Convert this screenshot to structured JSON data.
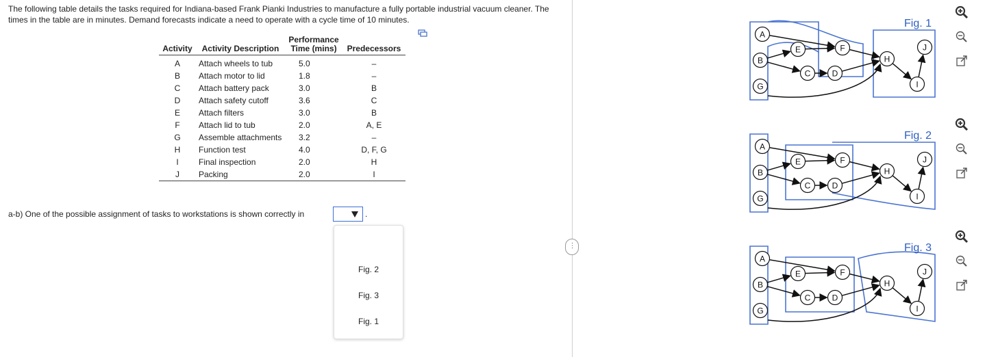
{
  "intro": "The following table details the tasks required for Indiana-based Frank Pianki Industries to manufacture a fully portable industrial vacuum cleaner. The times in the table are in minutes. Demand forecasts indicate a need to operate with a cycle time of 10 minutes.",
  "table": {
    "headers": {
      "activity": "Activity",
      "description": "Activity Description",
      "time": "Performance Time (mins)",
      "predecessors": "Predecessors"
    },
    "rows": [
      {
        "activity": "A",
        "description": "Attach wheels to tub",
        "time": "5.0",
        "pred": "–"
      },
      {
        "activity": "B",
        "description": "Attach motor to lid",
        "time": "1.8",
        "pred": "–"
      },
      {
        "activity": "C",
        "description": "Attach battery pack",
        "time": "3.0",
        "pred": "B"
      },
      {
        "activity": "D",
        "description": "Attach safety cutoff",
        "time": "3.6",
        "pred": "C"
      },
      {
        "activity": "E",
        "description": "Attach filters",
        "time": "3.0",
        "pred": "B"
      },
      {
        "activity": "F",
        "description": "Attach lid to tub",
        "time": "2.0",
        "pred": "A, E"
      },
      {
        "activity": "G",
        "description": "Assemble attachments",
        "time": "3.2",
        "pred": "–"
      },
      {
        "activity": "H",
        "description": "Function test",
        "time": "4.0",
        "pred": "D, F, G"
      },
      {
        "activity": "I",
        "description": "Final inspection",
        "time": "2.0",
        "pred": "H"
      },
      {
        "activity": "J",
        "description": "Packing",
        "time": "2.0",
        "pred": "I"
      }
    ]
  },
  "question": "a-b) One of the possible assignment of tasks to workstations is shown correctly in",
  "period": ".",
  "dropdown": {
    "selected": "",
    "options": [
      "Fig. 2",
      "Fig. 3",
      "Fig. 1"
    ]
  },
  "handle_glyph": "⋮",
  "figures": [
    {
      "label": "Fig. 1"
    },
    {
      "label": "Fig. 2"
    },
    {
      "label": "Fig. 3"
    }
  ],
  "node_labels": [
    "A",
    "B",
    "G",
    "E",
    "C",
    "F",
    "D",
    "H",
    "J",
    "I"
  ],
  "colors": {
    "accent": "#3b6fd6",
    "figure_label": "#2f5fc0",
    "text": "#222222"
  }
}
